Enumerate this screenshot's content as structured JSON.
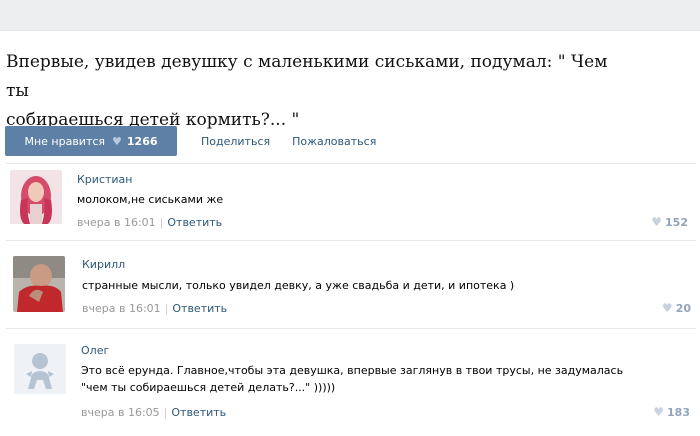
{
  "post": {
    "text_line1": "Впервые, увидев девушку с маленькими сиськами, подумал: \" Чем ты",
    "text_line2": "собираешься детей кормить?... \""
  },
  "actions": {
    "like_label": "Мне нравится",
    "like_count": "1266",
    "share_label": "Поделиться",
    "report_label": "Пожаловаться"
  },
  "comments": [
    {
      "author": "Кристиан",
      "lines": [
        "молоком,не сиськами же"
      ],
      "time": "вчера в 16:01",
      "reply": "Ответить",
      "likes": "152"
    },
    {
      "author": "Кирилл",
      "lines": [
        "странные мысли, только увидел девку, а уже свадьба и дети, и ипотека )"
      ],
      "time": "вчера в 16:01",
      "reply": "Ответить",
      "likes": "20"
    },
    {
      "author": "Олег",
      "lines": [
        "Это всё ерунда. Главное,чтобы эта девушка, впервые заглянув в твои трусы, не задумалась",
        "\"чем ты собираешься детей делать?...\" )))))"
      ],
      "time": "вчера в 16:05",
      "reply": "Ответить",
      "likes": "183"
    }
  ],
  "colors": {
    "accent": "#5e80a6",
    "link": "#2b587a",
    "meta": "#999999"
  },
  "icons": {
    "like": "heart-icon",
    "default_avatar": "person-silhouette-icon"
  }
}
